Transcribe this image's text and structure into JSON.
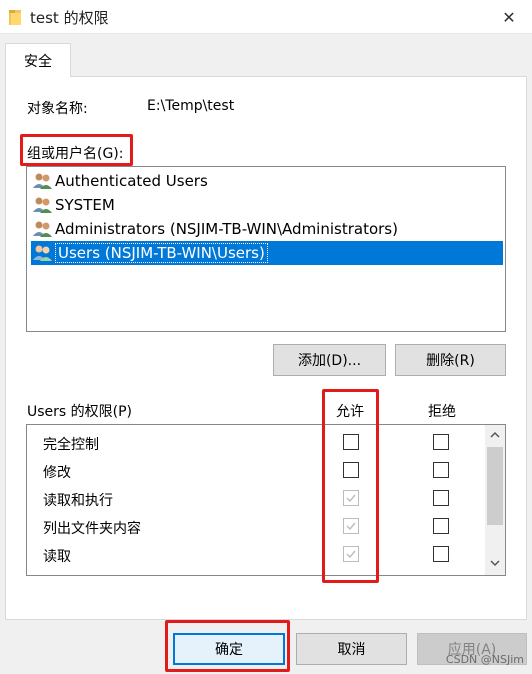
{
  "window": {
    "title": "test 的权限",
    "close_glyph": "✕"
  },
  "tabs": [
    {
      "label": "安全"
    }
  ],
  "object": {
    "label": "对象名称:",
    "value": "E:\\Temp\\test"
  },
  "groups": {
    "label": "组或用户名(G):",
    "items": [
      {
        "label": "Authenticated Users",
        "icon": "users-icon"
      },
      {
        "label": "SYSTEM",
        "icon": "users-icon"
      },
      {
        "label": "Administrators (NSJIM-TB-WIN\\Administrators)",
        "icon": "users-icon"
      },
      {
        "label": "Users (NSJIM-TB-WIN\\Users)",
        "icon": "users-icon",
        "selected": true
      }
    ]
  },
  "buttons": {
    "add": "添加(D)...",
    "remove": "删除(R)"
  },
  "permissions": {
    "label": "Users 的权限(P)",
    "allow_header": "允许",
    "deny_header": "拒绝",
    "rows": [
      {
        "name": "完全控制",
        "allow": false,
        "allow_inherited": false,
        "deny": false
      },
      {
        "name": "修改",
        "allow": false,
        "allow_inherited": false,
        "deny": false
      },
      {
        "name": "读取和执行",
        "allow": true,
        "allow_inherited": true,
        "deny": false
      },
      {
        "name": "列出文件夹内容",
        "allow": true,
        "allow_inherited": true,
        "deny": false
      },
      {
        "name": "读取",
        "allow": true,
        "allow_inherited": true,
        "deny": false
      }
    ]
  },
  "footer": {
    "ok": "确定",
    "cancel": "取消",
    "apply": "应用(A)"
  },
  "watermark": "CSDN @NSJim",
  "colors": {
    "selection": "#0078d7",
    "highlight": "#e31a1a"
  }
}
